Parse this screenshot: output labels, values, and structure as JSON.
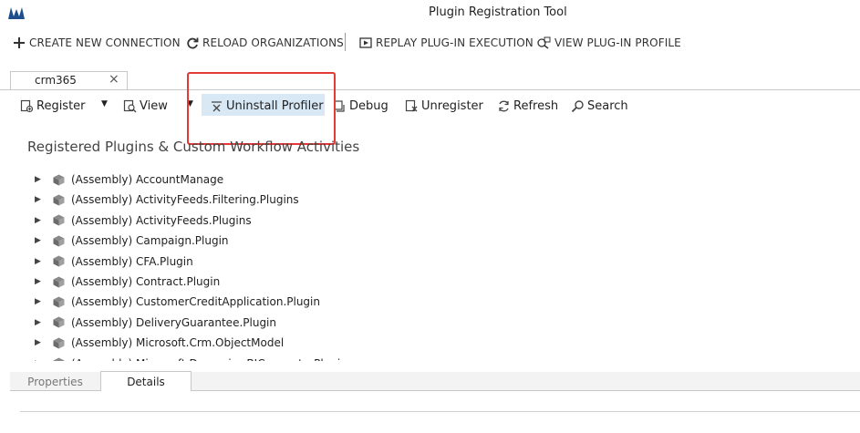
{
  "window": {
    "title": "Plugin Registration Tool"
  },
  "commands": {
    "create": "CREATE NEW CONNECTION",
    "reload": "RELOAD ORGANIZATIONS",
    "replay": "REPLAY PLUG-IN EXECUTION",
    "view_profile": "VIEW PLUG-IN PROFILE"
  },
  "tabs": [
    {
      "label": "crm365",
      "close": "×"
    }
  ],
  "toolbar": {
    "register": "Register",
    "view": "View",
    "uninstall_profiler": "Uninstall Profiler",
    "debug": "Debug",
    "unregister": "Unregister",
    "refresh": "Refresh",
    "search": "Search"
  },
  "section_title": "Registered Plugins & Custom Workflow Activities",
  "tree": [
    "(Assembly) AccountManage",
    "(Assembly) ActivityFeeds.Filtering.Plugins",
    "(Assembly) ActivityFeeds.Plugins",
    "(Assembly) Campaign.Plugin",
    "(Assembly) CFA.Plugin",
    "(Assembly) Contract.Plugin",
    "(Assembly) CustomerCreditApplication.Plugin",
    "(Assembly) DeliveryGuarantee.Plugin",
    "(Assembly) Microsoft.Crm.ObjectModel",
    "(Assembly) Microsoft.Dynamics.BIConnectorPlugin"
  ],
  "bottom_tabs": {
    "properties": "Properties",
    "details": "Details"
  },
  "colors": {
    "highlight": "#e53935",
    "selected_button": "#d8e8f5",
    "logo": "#1f4e8c"
  }
}
